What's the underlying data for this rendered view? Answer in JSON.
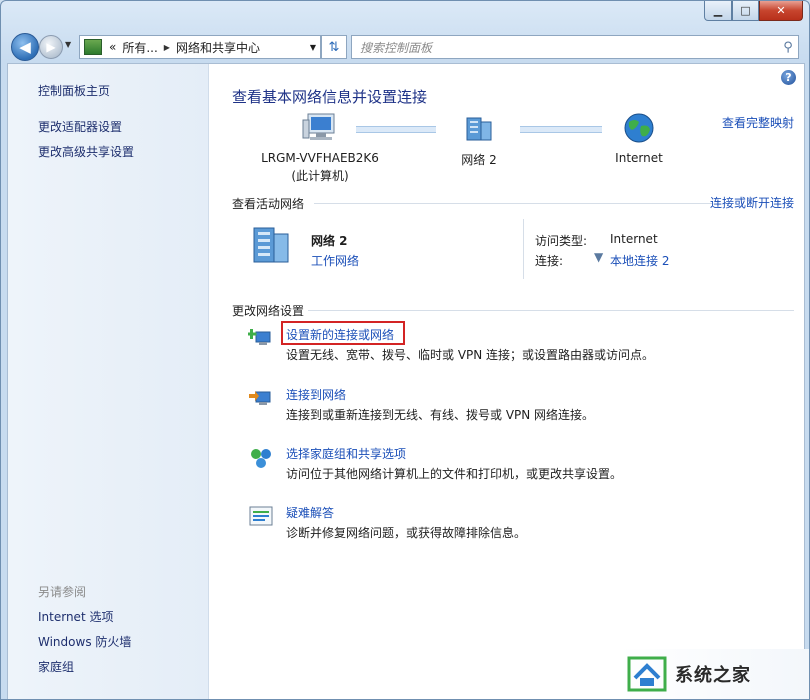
{
  "window": {
    "minimize": "▁",
    "maximize": "□",
    "close": "✕"
  },
  "address": {
    "chevrons": "«",
    "crumb1": "所有...",
    "crumb2": "网络和共享中心",
    "search_placeholder": "搜索控制面板"
  },
  "sidebar": {
    "items": [
      {
        "label": "控制面板主页"
      },
      {
        "label": "更改适配器设置"
      },
      {
        "label": "更改高级共享设置"
      }
    ],
    "see_also_title": "另请参阅",
    "see_also": [
      {
        "label": "Internet 选项"
      },
      {
        "label": "Windows 防火墙"
      },
      {
        "label": "家庭组"
      }
    ]
  },
  "main": {
    "title": "查看基本网络信息并设置连接",
    "full_map": "查看完整映射",
    "map": {
      "computer_name": "LRGM-VVFHAEB2K6",
      "computer_sub": "(此计算机)",
      "network": "网络 2",
      "internet": "Internet"
    },
    "active": {
      "section_title": "查看活动网络",
      "connect_link": "连接或断开连接",
      "network_name": "网络 2",
      "network_type": "工作网络",
      "access_label": "访问类型:",
      "access_value": "Internet",
      "conn_label": "连接:",
      "conn_value": "本地连接 2"
    },
    "change": {
      "section_title": "更改网络设置",
      "tasks": [
        {
          "link": "设置新的连接或网络",
          "desc": "设置无线、宽带、拨号、临时或 VPN 连接；或设置路由器或访问点。",
          "icon": "new-connection-icon"
        },
        {
          "link": "连接到网络",
          "desc": "连接到或重新连接到无线、有线、拨号或 VPN 网络连接。",
          "icon": "connect-network-icon"
        },
        {
          "link": "选择家庭组和共享选项",
          "desc": "访问位于其他网络计算机上的文件和打印机，或更改共享设置。",
          "icon": "homegroup-icon"
        },
        {
          "link": "疑难解答",
          "desc": "诊断并修复网络问题，或获得故障排除信息。",
          "icon": "troubleshoot-icon"
        }
      ]
    }
  },
  "watermark": {
    "text": "系统之家"
  },
  "colors": {
    "link": "#1b4fb8",
    "title": "#1e3287",
    "highlight": "#d32424"
  }
}
